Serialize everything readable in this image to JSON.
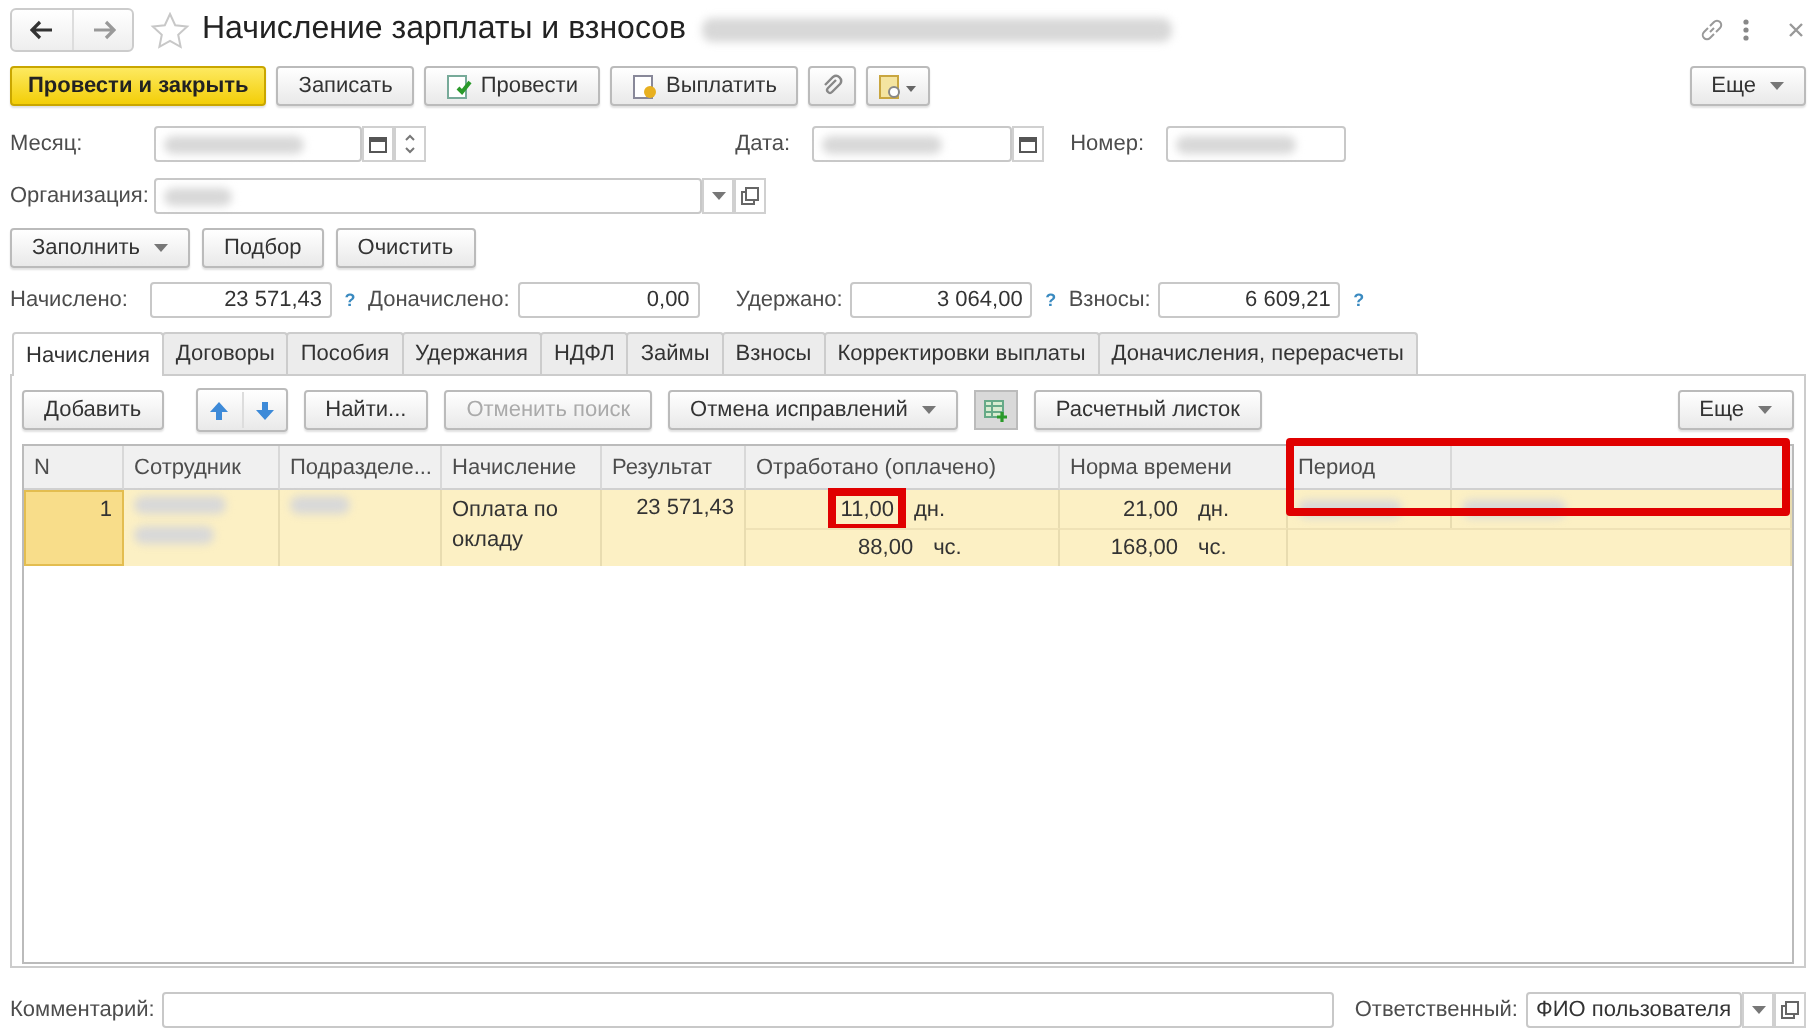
{
  "window": {
    "title": "Начисление зарплаты и взносов"
  },
  "commands": [
    {
      "label": "Провести и закрыть",
      "kind": "primary"
    },
    {
      "label": "Записать",
      "kind": "plain"
    },
    {
      "label": "Провести",
      "kind": "post"
    },
    {
      "label": "Выплатить",
      "kind": "pay"
    },
    {
      "kind": "attach"
    },
    {
      "kind": "report-menu"
    }
  ],
  "more_button": "Еще",
  "fields": {
    "month_label": "Месяц:",
    "date_label": "Дата:",
    "number_label": "Номер:",
    "organization_label": "Организация:"
  },
  "fill_buttons": [
    {
      "label": "Заполнить",
      "dropdown": true
    },
    {
      "label": "Подбор",
      "dropdown": false
    },
    {
      "label": "Очистить",
      "dropdown": false
    }
  ],
  "totals": [
    {
      "label": "Начислено:",
      "value": "23 571,43",
      "help": "?"
    },
    {
      "label": "Доначислено:",
      "value": "0,00"
    },
    {
      "label": "Удержано:",
      "value": "3 064,00",
      "help": "?"
    },
    {
      "label": "Взносы:",
      "value": "6 609,21",
      "help": "?"
    }
  ],
  "tabs": [
    {
      "label": "Начисления",
      "selected": true
    },
    {
      "label": "Договоры",
      "selected": false
    },
    {
      "label": "Пособия",
      "selected": false
    },
    {
      "label": "Удержания",
      "selected": false
    },
    {
      "label": "НДФЛ",
      "selected": false
    },
    {
      "label": "Займы",
      "selected": false
    },
    {
      "label": "Взносы",
      "selected": false
    },
    {
      "label": "Корректировки выплаты",
      "selected": false
    },
    {
      "label": "Доначисления, перерасчеты",
      "selected": false
    }
  ],
  "table_toolbar": [
    {
      "kind": "button",
      "label": "Добавить",
      "disabled": false
    },
    {
      "kind": "move-arrows"
    },
    {
      "kind": "button",
      "label": "Найти...",
      "disabled": false
    },
    {
      "kind": "button",
      "label": "Отменить поиск",
      "disabled": true
    },
    {
      "kind": "dropdown",
      "label": "Отмена исправлений",
      "disabled": false
    },
    {
      "kind": "pressed-icon"
    },
    {
      "kind": "button",
      "label": "Расчетный листок",
      "disabled": false
    }
  ],
  "table_more_button": "Еще",
  "table": {
    "columns": [
      {
        "title": "N"
      },
      {
        "title": "Сотрудник"
      },
      {
        "title": "Подразделе..."
      },
      {
        "title": "Начисление"
      },
      {
        "title": "Результат"
      },
      {
        "title": "Отработано (оплачено)"
      },
      {
        "title": "Норма времени"
      },
      {
        "title": "Период"
      }
    ],
    "period_highlighted": true,
    "rows": [
      {
        "n": "1",
        "accrual": "Оплата по окладу",
        "result": "23 571,43",
        "worked": [
          {
            "value": "11,00",
            "unit": "дн.",
            "highlighted": true
          },
          {
            "value": "88,00",
            "unit": "чс.",
            "highlighted": false
          }
        ],
        "norm": [
          {
            "value": "21,00",
            "unit": "дн."
          },
          {
            "value": "168,00",
            "unit": "чс."
          }
        ]
      }
    ]
  },
  "footer": {
    "comment_label": "Комментарий:",
    "responsible_label": "Ответственный:",
    "responsible_value": "ФИО пользователя"
  }
}
